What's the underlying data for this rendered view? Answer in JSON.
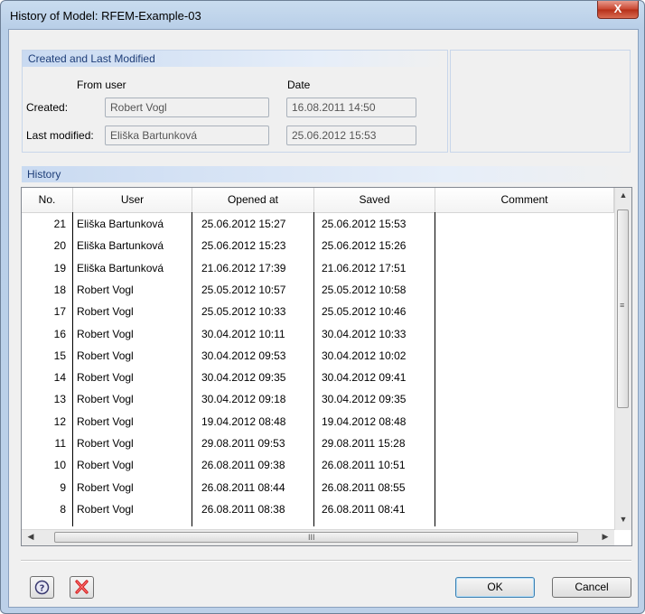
{
  "window": {
    "title": "History of Model: RFEM-Example-03",
    "close_glyph": "X"
  },
  "created_group": {
    "header": "Created and Last Modified",
    "col_from_user": "From user",
    "col_date": "Date",
    "created_label": "Created:",
    "created_user": "Robert Vogl",
    "created_date": "16.08.2011 14:50",
    "modified_label": "Last modified:",
    "modified_user": "Eliška Bartunková",
    "modified_date": "25.06.2012 15:53"
  },
  "history": {
    "header": "History",
    "columns": [
      "No.",
      "User",
      "Opened at",
      "Saved",
      "Comment"
    ],
    "rows": [
      [
        "21",
        "Eliška Bartunková",
        "25.06.2012 15:27",
        "25.06.2012 15:53",
        ""
      ],
      [
        "20",
        "Eliška Bartunková",
        "25.06.2012 15:23",
        "25.06.2012 15:26",
        ""
      ],
      [
        "19",
        "Eliška Bartunková",
        "21.06.2012 17:39",
        "21.06.2012 17:51",
        ""
      ],
      [
        "18",
        "Robert Vogl",
        "25.05.2012 10:57",
        "25.05.2012 10:58",
        ""
      ],
      [
        "17",
        "Robert Vogl",
        "25.05.2012 10:33",
        "25.05.2012 10:46",
        ""
      ],
      [
        "16",
        "Robert Vogl",
        "30.04.2012 10:11",
        "30.04.2012 10:33",
        ""
      ],
      [
        "15",
        "Robert Vogl",
        "30.04.2012 09:53",
        "30.04.2012 10:02",
        ""
      ],
      [
        "14",
        "Robert Vogl",
        "30.04.2012 09:35",
        "30.04.2012 09:41",
        ""
      ],
      [
        "13",
        "Robert Vogl",
        "30.04.2012 09:18",
        "30.04.2012 09:35",
        ""
      ],
      [
        "12",
        "Robert Vogl",
        "19.04.2012 08:48",
        "19.04.2012 08:48",
        ""
      ],
      [
        "11",
        "Robert Vogl",
        "29.08.2011 09:53",
        "29.08.2011 15:28",
        ""
      ],
      [
        "10",
        "Robert Vogl",
        "26.08.2011 09:38",
        "26.08.2011 10:51",
        ""
      ],
      [
        "9",
        "Robert Vogl",
        "26.08.2011 08:44",
        "26.08.2011 08:55",
        ""
      ],
      [
        "8",
        "Robert Vogl",
        "26.08.2011 08:38",
        "26.08.2011 08:41",
        ""
      ]
    ]
  },
  "footer": {
    "help_icon": "help-icon",
    "reset_icon": "red-x-icon",
    "ok_label": "OK",
    "cancel_label": "Cancel"
  },
  "scrollbar": {
    "h_grip": "III",
    "v_grip": "≡"
  }
}
